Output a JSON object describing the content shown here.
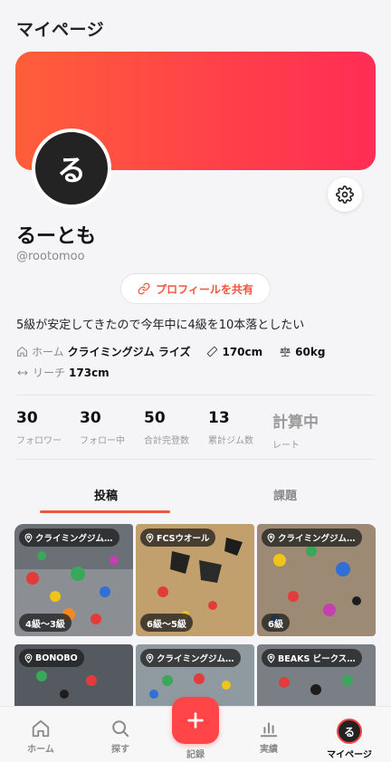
{
  "header": {
    "title": "マイページ"
  },
  "colors": {
    "accent": "#f2553f",
    "banner_start": "#ff5e3a",
    "banner_end": "#ff2d55",
    "fab": "#ff4548",
    "avatar_bg": "#232323"
  },
  "profile": {
    "avatar_char": "る",
    "name": "るーとも",
    "handle": "@rootomoo",
    "share_label": "プロフィールを共有",
    "bio": "5級が安定してきたので今年中に4級を10本落としたい",
    "home_label": "ホーム",
    "home_gym": "クライミングジム ライズ",
    "height": "170cm",
    "weight": "60kg",
    "reach_label": "リーチ",
    "reach": "173cm"
  },
  "stats": [
    {
      "value": "30",
      "label": "フォロワー"
    },
    {
      "value": "30",
      "label": "フォロー中"
    },
    {
      "value": "50",
      "label": "合計完登数"
    },
    {
      "value": "13",
      "label": "累計ジム数"
    },
    {
      "value": "計算中",
      "label": "レート"
    }
  ],
  "tabs": [
    {
      "label": "投稿",
      "active": true
    },
    {
      "label": "課題",
      "active": false
    }
  ],
  "posts": [
    {
      "gym": "クライミングジム…",
      "grade": "4級〜3級"
    },
    {
      "gym": "FCSウオール",
      "grade": "6級〜5級"
    },
    {
      "gym": "クライミングジム…",
      "grade": "6級"
    },
    {
      "gym": "BONOBO",
      "grade": ""
    },
    {
      "gym": "クライミングジム…",
      "grade": ""
    },
    {
      "gym": "BEAKS ビークス…",
      "grade": ""
    }
  ],
  "bottom_nav": [
    {
      "label": "ホーム",
      "icon": "home-icon"
    },
    {
      "label": "探す",
      "icon": "search-icon"
    },
    {
      "label": "記録",
      "icon": "plus-icon"
    },
    {
      "label": "実績",
      "icon": "bar-chart-icon"
    },
    {
      "label": "マイページ",
      "icon": "avatar"
    }
  ]
}
